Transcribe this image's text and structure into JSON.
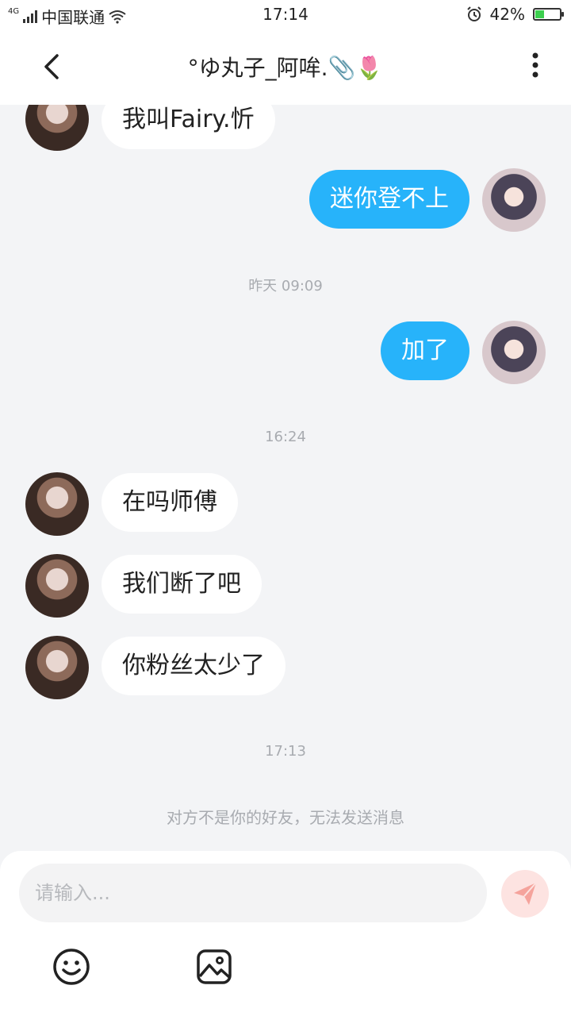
{
  "status_bar": {
    "network": "4G",
    "carrier": "中国联通",
    "time": "17:14",
    "battery_text": "42%",
    "battery_level": 0.42,
    "icons": [
      "signal-icon",
      "wifi-icon",
      "alarm-icon",
      "battery-icon"
    ]
  },
  "header": {
    "title": "°ゆ丸子_阿哞.📎🌷",
    "back_icon": "chevron-left-icon",
    "more_icon": "more-vertical-icon"
  },
  "messages": [
    {
      "side": "other",
      "text": "我叫Fairy.忻"
    },
    {
      "side": "self",
      "text": "迷你登不上"
    },
    {
      "type": "timestamp",
      "text": "昨天 09:09"
    },
    {
      "side": "self",
      "text": "加了"
    },
    {
      "type": "timestamp",
      "text": "16:24"
    },
    {
      "side": "other",
      "text": "在吗师傅"
    },
    {
      "side": "other",
      "text": "我们断了吧"
    },
    {
      "side": "other",
      "text": "你粉丝太少了"
    },
    {
      "type": "timestamp",
      "text": "17:13"
    },
    {
      "type": "notice",
      "text": "对方不是你的好友，无法发送消息"
    }
  ],
  "input": {
    "placeholder": "请输入...",
    "value": ""
  },
  "toolbar": {
    "send_icon": "send-icon",
    "emoji_icon": "emoji-icon",
    "image_icon": "image-icon"
  },
  "colors": {
    "self_bubble": "#27b3fa",
    "other_bubble": "#ffffff",
    "background": "#f3f4f6",
    "send_disabled": "#fde3e1",
    "send_icon": "#f5a39c",
    "meta_text": "#a8abb0"
  }
}
